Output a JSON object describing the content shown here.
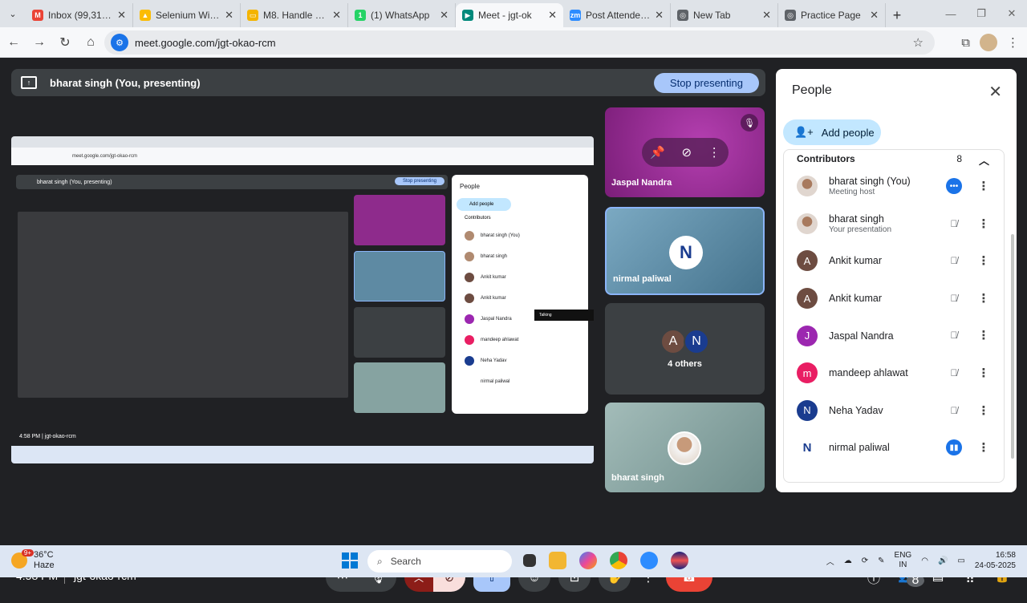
{
  "browser": {
    "tabs": [
      {
        "title": "Inbox (99,316) -",
        "favicon": "gmail",
        "color": "#ea4335",
        "glyph": "M",
        "active": false
      },
      {
        "title": "Selenium With J",
        "favicon": "drive",
        "color": "#fbbc04",
        "glyph": "▲",
        "active": false
      },
      {
        "title": "M8. Handle Chec",
        "favicon": "slides",
        "color": "#f4b400",
        "glyph": "▭",
        "active": false
      },
      {
        "title": "(1) WhatsApp",
        "favicon": "whatsapp",
        "color": "#25d366",
        "glyph": "1",
        "active": false
      },
      {
        "title": "Meet - jgt-ok",
        "favicon": "meet",
        "color": "#00897b",
        "glyph": "▶",
        "active": true
      },
      {
        "title": "Post Attendee -",
        "favicon": "zoom",
        "color": "#2d8cff",
        "glyph": "zm",
        "active": false
      },
      {
        "title": "New Tab",
        "favicon": "chrome",
        "color": "#5f6368",
        "glyph": "◎",
        "active": false
      },
      {
        "title": "Practice Page",
        "favicon": "globe",
        "color": "#5f6368",
        "glyph": "◎",
        "active": false
      }
    ],
    "url": "meet.google.com/jgt-okao-rcm"
  },
  "presenting": {
    "label": "bharat singh (You, presenting)",
    "stop_label": "Stop presenting"
  },
  "shared_screen": {
    "mini_url": "meet.google.com/jgt-okao-rcm",
    "mini_present": "bharat singh (You, presenting)",
    "mini_stop": "Stop presenting",
    "mini_people_title": "People",
    "mini_add": "Add people",
    "mini_contrib": "Contributors",
    "mini_talking": "Talking",
    "mini_time_code": "4:58 PM | jgt-okao-rcm"
  },
  "tiles": {
    "jaspal": "Jaspal Nandra",
    "nirmal": "nirmal paliwal",
    "others_label": "4 others",
    "others_a": "A",
    "others_n": "N",
    "nirmal_initial": "N",
    "bharat": "bharat singh"
  },
  "people_panel": {
    "title": "People",
    "add_people": "Add people",
    "section": "Contributors",
    "count": "8",
    "people": [
      {
        "name": "bharat singh (You)",
        "sub": "Meeting host",
        "avatar": "photo",
        "initial": "",
        "color": "",
        "status": "more-options-blue"
      },
      {
        "name": "bharat singh",
        "sub": "Your presentation",
        "avatar": "photo",
        "initial": "",
        "color": "",
        "status": "muted"
      },
      {
        "name": "Ankit kumar",
        "sub": "",
        "avatar": "letter",
        "initial": "A",
        "color": "#6d4c41",
        "status": "muted"
      },
      {
        "name": "Ankit kumar",
        "sub": "",
        "avatar": "letter",
        "initial": "A",
        "color": "#6d4c41",
        "status": "muted"
      },
      {
        "name": "Jaspal Nandra",
        "sub": "",
        "avatar": "letter",
        "initial": "J",
        "color": "#9c27b0",
        "status": "muted"
      },
      {
        "name": "mandeep ahlawat",
        "sub": "",
        "avatar": "letter",
        "initial": "m",
        "color": "#e91e63",
        "status": "muted"
      },
      {
        "name": "Neha Yadav",
        "sub": "",
        "avatar": "letter",
        "initial": "N",
        "color": "#1a3c8f",
        "status": "muted"
      },
      {
        "name": "nirmal paliwal",
        "sub": "",
        "avatar": "logo",
        "initial": "N",
        "color": "#ffffff",
        "status": "speaking-blue"
      }
    ]
  },
  "meet_bar": {
    "time": "4:58 PM",
    "code": "jgt-okao-rcm",
    "people_badge": "8"
  },
  "taskbar": {
    "temp": "36°C",
    "condition": "Haze",
    "notif": "9+",
    "search": "Search",
    "lang1": "ENG",
    "lang2": "IN",
    "time": "16:58",
    "date": "24-05-2025"
  }
}
